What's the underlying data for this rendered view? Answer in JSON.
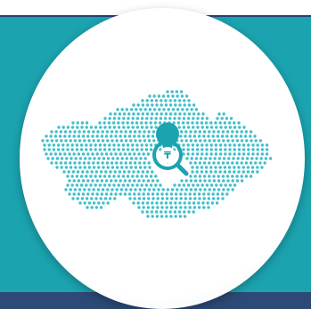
{
  "colors": {
    "background": "#ffffff",
    "top_rule": "#2a3f73",
    "teal_panel": "#1ba3af",
    "bottom_band": "#2c4a75",
    "disc": "#ffffff",
    "map_dots": "#45bfc9",
    "marker": "#1ba3af",
    "marker_symbol": "#ffffff"
  },
  "map": {
    "icon": "kazakhstan-dotted-map-icon"
  },
  "marker": {
    "icon": "search-location-pin-icon",
    "symbol": "₸"
  }
}
